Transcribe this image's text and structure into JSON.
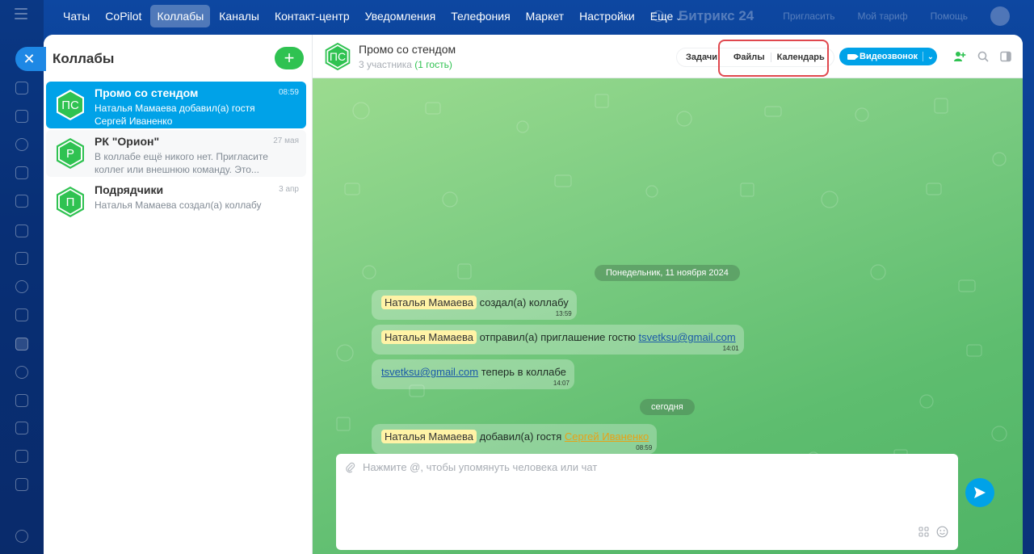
{
  "topnav": {
    "items": [
      {
        "label": "Чаты",
        "active": false
      },
      {
        "label": "CoPilot",
        "active": false
      },
      {
        "label": "Коллабы",
        "active": true
      },
      {
        "label": "Каналы",
        "active": false
      },
      {
        "label": "Контакт-центр",
        "active": false
      },
      {
        "label": "Уведомления",
        "active": false
      },
      {
        "label": "Телефония",
        "active": false
      },
      {
        "label": "Маркет",
        "active": false
      },
      {
        "label": "Настройки",
        "active": false
      }
    ],
    "more_label": "Еще",
    "logo": "Битрикс 24",
    "invite": "Пригласить",
    "tariff": "Мой тариф",
    "help": "Помощь"
  },
  "sidebar": {
    "title": "Коллабы",
    "add_label": "+",
    "items": [
      {
        "initials": "ПС",
        "name": "Промо со стендом",
        "time": "08:59",
        "preview": "Наталья Мамаева добавил(а) гостя Сергей Иваненко",
        "selected": true,
        "bg": "grey"
      },
      {
        "initials": "Р",
        "name": "РК \"Орион\"",
        "time": "27 мая",
        "preview": "В коллабе ещё никого нет. Пригласите коллег или внешнюю команду. Это...",
        "selected": false,
        "bg": "grey"
      },
      {
        "initials": "П",
        "name": "Подрядчики",
        "time": "3 апр",
        "preview": "Наталья Мамаева создал(а) коллабу",
        "selected": false,
        "bg": "white"
      }
    ]
  },
  "chat": {
    "initials": "ПС",
    "title": "Промо со стендом",
    "participants": "3 участника",
    "guests": "(1 гость)",
    "tabs": [
      "Задачи",
      "Файлы",
      "Календарь"
    ],
    "video_label": "Видеозвонок",
    "date_1": "Понедельник, 11 ноября 2024",
    "date_2": "сегодня",
    "messages": [
      {
        "user": "Наталья Мамаева",
        "text": "создал(а) коллабу",
        "time": "13:59"
      },
      {
        "user": "Наталья Мамаева",
        "text": "отправил(а) приглашение гостю",
        "link": "tsvetksu@gmail.com",
        "time": "14:01"
      },
      {
        "link": "tsvetksu@gmail.com",
        "text": "теперь в коллабе",
        "time": "14:07"
      },
      {
        "user": "Наталья Мамаева",
        "text": "добавил(а) гостя",
        "guest": "Сергей Иваненко",
        "time": "08:59"
      }
    ],
    "composer_placeholder": "Нажмите @, чтобы упомянуть человека или чат"
  },
  "colors": {
    "accent": "#00a2e8",
    "green": "#2fc251",
    "highlight": "#e0484e",
    "user_chip": "#fff3a6"
  }
}
